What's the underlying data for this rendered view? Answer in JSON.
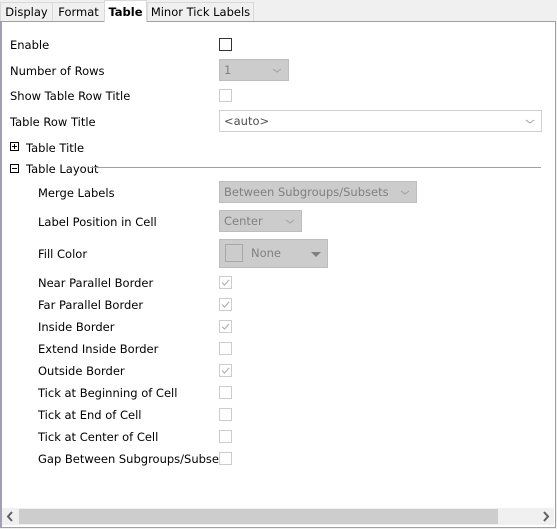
{
  "tabs": [
    {
      "label": "Display",
      "active": false
    },
    {
      "label": "Format",
      "active": false
    },
    {
      "label": "Table",
      "active": true
    },
    {
      "label": "Minor Tick Labels",
      "active": false
    }
  ],
  "form": {
    "enable": {
      "label": "Enable",
      "checked": false
    },
    "number_of_rows": {
      "label": "Number of Rows",
      "value": "1"
    },
    "show_table_row_title": {
      "label": "Show Table Row Title",
      "checked": false
    },
    "table_row_title": {
      "label": "Table Row Title",
      "value": "<auto>"
    }
  },
  "sections": {
    "table_title": {
      "label": "Table Title",
      "expanded": false
    },
    "table_layout": {
      "label": "Table Layout",
      "expanded": true
    }
  },
  "layout": {
    "merge_labels": {
      "label": "Merge Labels",
      "value": "Between Subgroups/Subsets"
    },
    "label_position": {
      "label": "Label Position in Cell",
      "value": "Center"
    },
    "fill_color": {
      "label": "Fill Color",
      "value": "None"
    },
    "checkboxes": [
      {
        "label": "Near Parallel Border",
        "checked": true
      },
      {
        "label": "Far Parallel Border",
        "checked": true
      },
      {
        "label": "Inside Border",
        "checked": true
      },
      {
        "label": "Extend Inside Border",
        "checked": false
      },
      {
        "label": "Outside Border",
        "checked": true
      },
      {
        "label": "Tick at Beginning of Cell",
        "checked": false
      },
      {
        "label": "Tick at End of Cell",
        "checked": false
      },
      {
        "label": "Tick at Center of Cell",
        "checked": false
      },
      {
        "label": "Gap Between Subgroups/Subsets",
        "checked": false
      }
    ]
  },
  "colors": {
    "disabled_bg": "#cccccc",
    "panel_bg": "#ffffff",
    "chrome_bg": "#f0f0f0"
  }
}
